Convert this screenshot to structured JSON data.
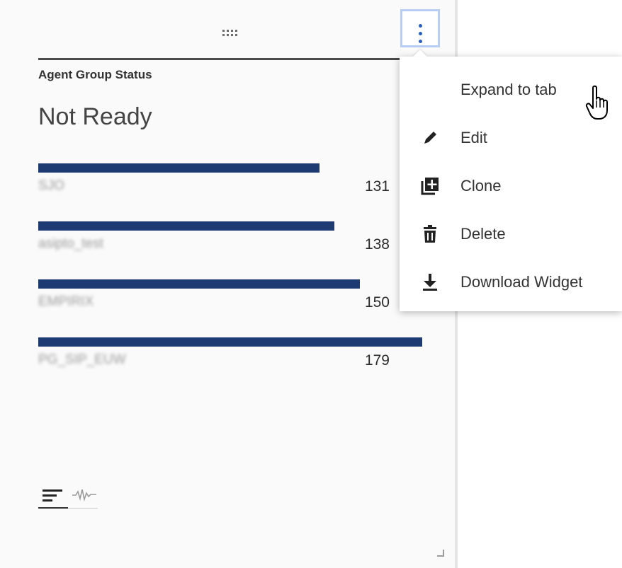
{
  "widget": {
    "title": "Agent Group Status",
    "status": "Not Ready",
    "rows": [
      {
        "label": "SJO",
        "value": "131"
      },
      {
        "label": "asipto_test",
        "value": "138"
      },
      {
        "label": "EMPIRIX",
        "value": "150"
      },
      {
        "label": "PG_SIP_EUW",
        "value": "179"
      }
    ],
    "bar_max_value": 179,
    "selected_view": "list-view"
  },
  "menu": {
    "items": [
      {
        "label": "Expand to tab",
        "icon": "expand-to-tab-icon",
        "highlighted": true
      },
      {
        "label": "Edit",
        "icon": "pencil-icon",
        "highlighted": false
      },
      {
        "label": "Clone",
        "icon": "clone-icon",
        "highlighted": false
      },
      {
        "label": "Delete",
        "icon": "trash-icon",
        "highlighted": false
      },
      {
        "label": "Download Widget",
        "icon": "download-icon",
        "highlighted": false
      }
    ]
  },
  "colors": {
    "accent": "#2a5fc4",
    "bar": "#1e3a72",
    "focus_ring": "#b7cdf3"
  }
}
